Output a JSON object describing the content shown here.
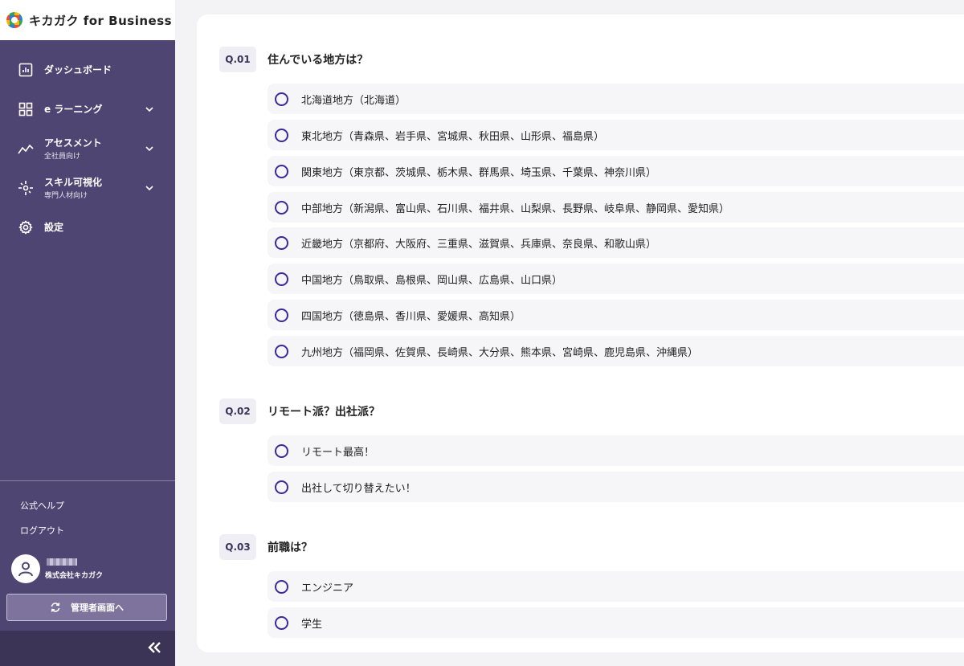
{
  "brand": {
    "name": "キカガク for Business"
  },
  "nav": [
    {
      "label": "ダッシュボード",
      "sub": null,
      "icon": "chart-icon",
      "chevron": false
    },
    {
      "label": "e ラーニング",
      "sub": null,
      "icon": "grid-icon",
      "chevron": true
    },
    {
      "label": "アセスメント",
      "sub": "全社員向け",
      "icon": "trend-icon",
      "chevron": true
    },
    {
      "label": "スキル可視化",
      "sub": "専門人材向け",
      "icon": "spark-icon",
      "chevron": true
    },
    {
      "label": "設定",
      "sub": null,
      "icon": "gear-icon",
      "chevron": false
    }
  ],
  "footer": {
    "help": "公式ヘルプ",
    "logout": "ログアウト",
    "company": "株式会社キカガク",
    "admin_button": "管理者画面へ"
  },
  "questions": [
    {
      "num": "Q.01",
      "text": "住んでいる地方は？",
      "options": [
        "北海道地方（北海道）",
        "東北地方（青森県、岩手県、宮城県、秋田県、山形県、福島県）",
        "関東地方（東京都、茨城県、栃木県、群馬県、埼玉県、千葉県、神奈川県）",
        "中部地方（新潟県、富山県、石川県、福井県、山梨県、長野県、岐阜県、静岡県、愛知県）",
        "近畿地方（京都府、大阪府、三重県、滋賀県、兵庫県、奈良県、和歌山県）",
        "中国地方（鳥取県、島根県、岡山県、広島県、山口県）",
        "四国地方（徳島県、香川県、愛媛県、高知県）",
        "九州地方（福岡県、佐賀県、長崎県、大分県、熊本県、宮崎県、鹿児島県、沖縄県）"
      ]
    },
    {
      "num": "Q.02",
      "text": "リモート派？出社派？",
      "options": [
        "リモート最高！",
        "出社して切り替えたい！"
      ]
    },
    {
      "num": "Q.03",
      "text": "前職は？",
      "options": [
        "エンジニア",
        "学生"
      ]
    }
  ]
}
